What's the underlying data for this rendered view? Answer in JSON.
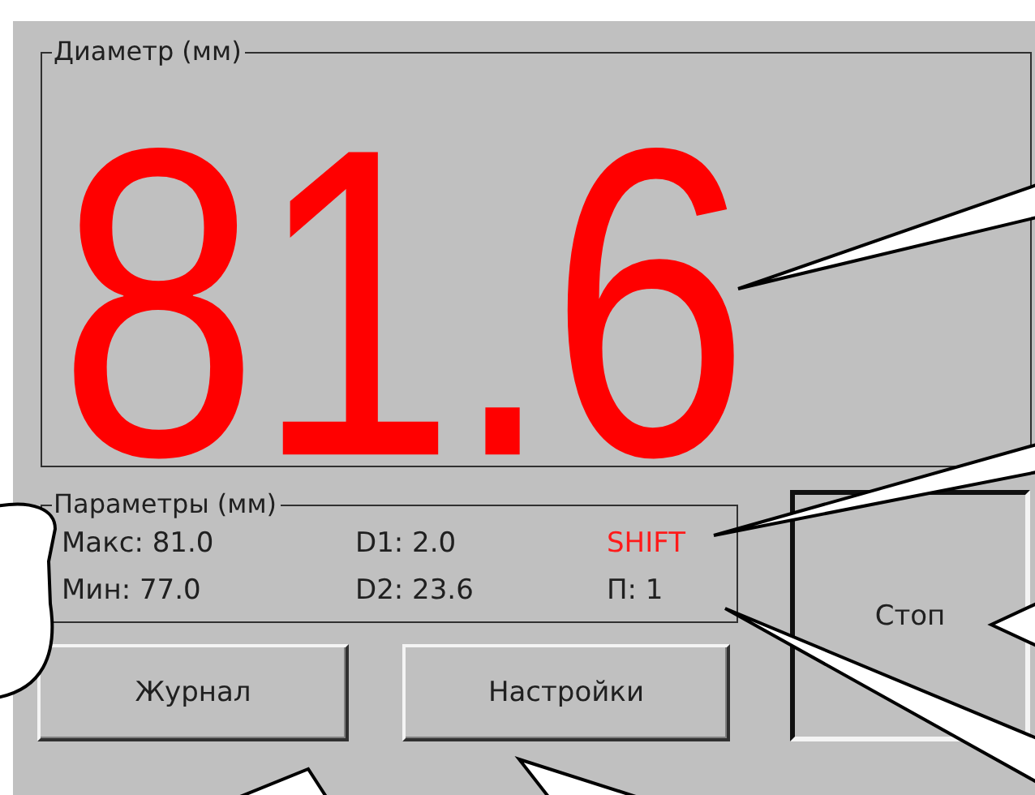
{
  "diameter": {
    "title": "Диаметр (мм)",
    "value": "81.6"
  },
  "parameters": {
    "title": "Параметры (мм)",
    "cells": [
      {
        "text": "Макс: 81.0",
        "kind": "plain"
      },
      {
        "text": "D1: 2.0",
        "kind": "plain"
      },
      {
        "text": "SHIFT",
        "kind": "alert"
      },
      {
        "text": "Мин: 77.0",
        "kind": "plain"
      },
      {
        "text": "D2: 23.6",
        "kind": "plain"
      },
      {
        "text": "П: 1",
        "kind": "plain"
      }
    ]
  },
  "buttons": [
    {
      "label": "Журнал"
    },
    {
      "label": "Настройки"
    }
  ],
  "stop_button": {
    "label": "Стоп",
    "pressed": true
  }
}
